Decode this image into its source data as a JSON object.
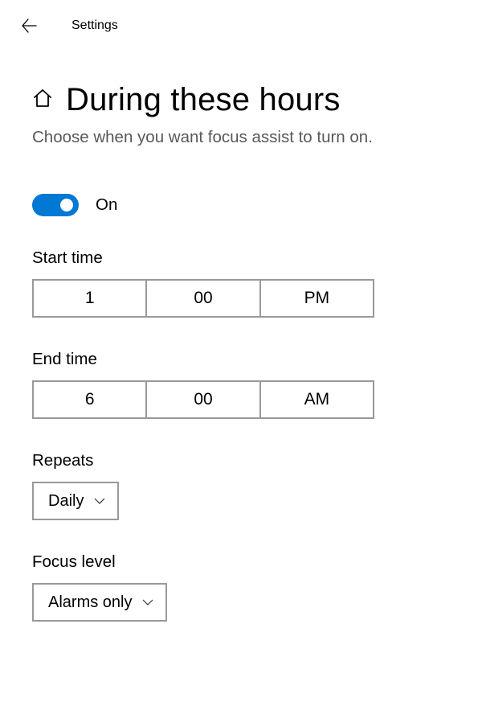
{
  "header": {
    "title": "Settings"
  },
  "page": {
    "title": "During these hours",
    "description": "Choose when you want focus assist to turn on."
  },
  "toggle": {
    "state": "On"
  },
  "startTime": {
    "label": "Start time",
    "hour": "1",
    "minute": "00",
    "period": "PM"
  },
  "endTime": {
    "label": "End time",
    "hour": "6",
    "minute": "00",
    "period": "AM"
  },
  "repeats": {
    "label": "Repeats",
    "value": "Daily"
  },
  "focusLevel": {
    "label": "Focus level",
    "value": "Alarms only"
  }
}
